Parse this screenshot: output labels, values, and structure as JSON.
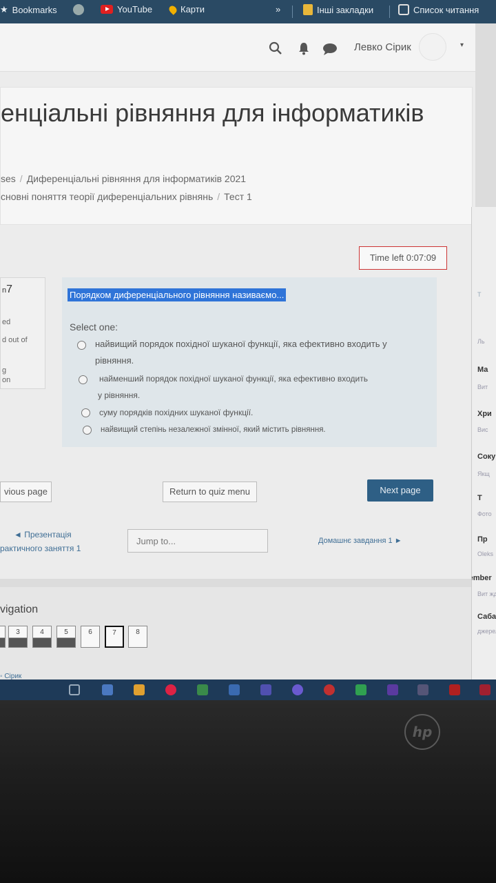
{
  "bookmarks_bar": {
    "items": [
      {
        "label": "Bookmarks",
        "icon": "bookmark-icon"
      },
      {
        "label": "",
        "icon": "globe-icon"
      },
      {
        "label": "YouTube",
        "icon": "youtube-icon"
      },
      {
        "label": "Карти",
        "icon": "maps-icon"
      }
    ],
    "overflow": "»",
    "other_bookmarks": "Інші закладки",
    "reading_list": "Список читання"
  },
  "navbar": {
    "user_name": "Левко Сірик",
    "caret": "▾"
  },
  "header": {
    "course_title": "енціальні рівняння для інформатиків",
    "breadcrumb_1": [
      "ses",
      "Диференціальні рівняння для інформатиків 2021"
    ],
    "breadcrumb_2": [
      "сновні поняття теорії диференціальних рівнянь",
      "Тест 1"
    ],
    "separator": "/"
  },
  "timer": "Time left 0:07:09",
  "question_info": {
    "number_prefix": "n",
    "number": "7",
    "status": "ed",
    "marks": "d out of",
    "flag_1": "g",
    "flag_2": "on"
  },
  "question": {
    "text": "Порядком диференціального рівняння називаємо...",
    "select_one": "Select one:",
    "answers": [
      {
        "line1": "найвищий порядок похідної шуканої функції, яка ефективно входить у",
        "line2": "рівняння."
      },
      {
        "line1": "найменший порядок похідної шуканої функції, яка ефективно входить",
        "line2": "у рівняння."
      },
      {
        "line1": "суму порядків похідних шуканої функції.",
        "line2": ""
      },
      {
        "line1": "найвищий степінь незалежної змінної, який містить рівняння.",
        "line2": ""
      }
    ]
  },
  "buttons": {
    "previous": "vious page",
    "quiz_menu": "Return to quiz menu",
    "next": "Next page"
  },
  "activity_nav": {
    "prev_link_1": "◄ Презентація",
    "prev_link_2": "рактичного заняття 1",
    "jump_placeholder": "Jump to...",
    "next_link": "Домашнє завдання 1 ►"
  },
  "quiz_navigation": {
    "title": "vigation",
    "boxes": [
      {
        "label": "",
        "state": "answered"
      },
      {
        "label": "3",
        "state": "answered"
      },
      {
        "label": "4",
        "state": "answered"
      },
      {
        "label": "5",
        "state": "answered"
      },
      {
        "label": "6",
        "state": "unanswered"
      },
      {
        "label": "7",
        "state": "current"
      },
      {
        "label": "8",
        "state": "unanswered"
      }
    ],
    "footer_user": "Сірик"
  },
  "side_panel": {
    "items": [
      {
        "title": "Ма",
        "sub": "Вит"
      },
      {
        "title": "Хри",
        "sub": "Вис"
      },
      {
        "title": "Соку",
        "sub": "Якщ"
      },
      {
        "title": "Т",
        "sub": "Фото"
      },
      {
        "title": "Пр",
        "sub": "Oleks"
      },
      {
        "title": "tember",
        "sub": "Вит жд"
      },
      {
        "title": "Сабада",
        "sub": "джерел"
      }
    ],
    "top_labels": [
      "Т",
      "Ль"
    ]
  },
  "laptop_brand": "hp"
}
